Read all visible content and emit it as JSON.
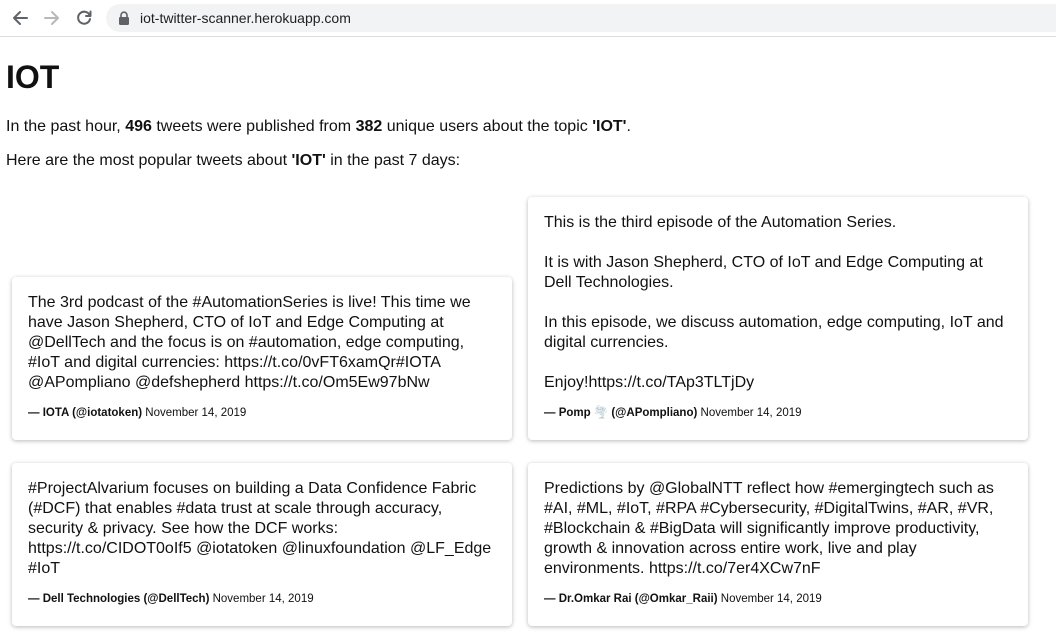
{
  "browser": {
    "url": "iot-twitter-scanner.herokuapp.com"
  },
  "page": {
    "title": "IOT",
    "stats": {
      "prefix": "In the past hour, ",
      "tweet_count": "496",
      "middle": " tweets were published from ",
      "user_count": "382",
      "middle2": " unique users about the topic ",
      "topic": "'IOT'",
      "suffix": "."
    },
    "intro": {
      "prefix": "Here are the most popular tweets about ",
      "topic": "'IOT'",
      "suffix": " in the past 7 days:"
    }
  },
  "tweets": [
    {
      "text": "The 3rd podcast of the #AutomationSeries is live! This time we have Jason Shepherd, CTO of IoT and Edge Computing at @DellTech and the focus is on #automation, edge computing, #IoT and digital currencies: https://t.co/0vFT6xamQr#IOTA @APompliano @defshepherd https://t.co/Om5Ew97bNw",
      "author": "— IOTA (@iotatoken)",
      "date": "November 14, 2019"
    },
    {
      "text": "This is the third episode of the Automation Series.\n\nIt is with Jason Shepherd, CTO of IoT and Edge Computing at Dell Technologies.\n\nIn this episode, we discuss automation, edge computing, IoT and digital currencies.\n\nEnjoy!https://t.co/TAp3TLTjDy",
      "author": "— Pomp 🌪️ (@APompliano)",
      "date": "November 14, 2019"
    },
    {
      "text": "#ProjectAlvarium focuses on building a Data Confidence Fabric (#DCF) that enables #data trust at scale through accuracy, security & privacy. See how the DCF works: https://t.co/CIDOT0oIf5 @iotatoken @linuxfoundation @LF_Edge #IoT",
      "author": "— Dell Technologies (@DellTech)",
      "date": "November 14, 2019"
    },
    {
      "text": "Predictions by @GlobalNTT reflect how #emergingtech such as #AI, #ML, #IoT, #RPA #Cybersecurity, #DigitalTwins, #AR, #VR, #Blockchain & #BigData will significantly improve productivity, growth & innovation across entire work, live and play environments. https://t.co/7er4XCw7nF",
      "author": "— Dr.Omkar Rai (@Omkar_Raii)",
      "date": "November 14, 2019"
    }
  ]
}
